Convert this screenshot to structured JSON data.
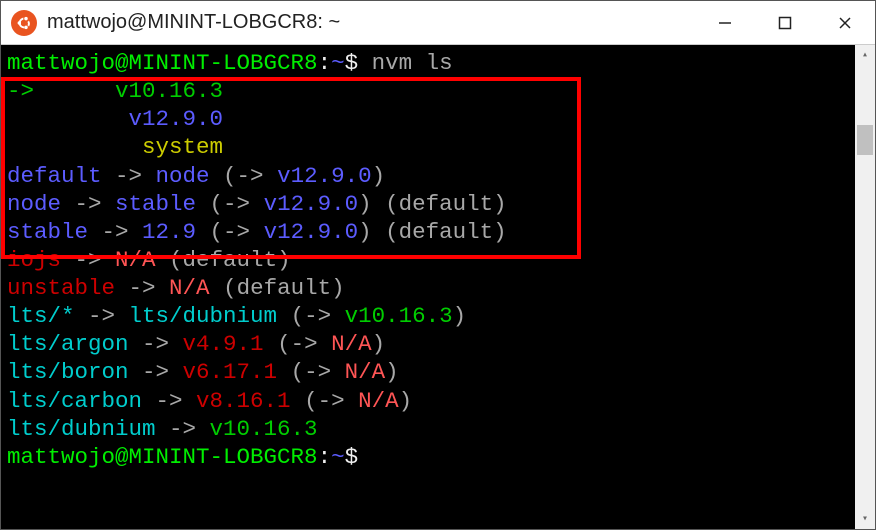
{
  "window": {
    "title": "mattwojo@MININT-LOBGCR8: ~"
  },
  "prompt": {
    "user_host": "mattwojo@MININT-LOBGCR8",
    "sep": ":",
    "path": "~",
    "dollar": "$"
  },
  "command": " nvm ls",
  "lines": {
    "arrow": "->",
    "v10": "v10.16.3",
    "v12": "v12.9.0",
    "system": "system",
    "default_k": "default",
    "to": " -> ",
    "node_w": "node",
    "pl": " (-> ",
    "pr": ")",
    "p_default": " (default)",
    "stable_w": "stable",
    "v129": "12.9",
    "iojs_k": "iojs",
    "na": "N/A",
    "unstable_k": "unstable",
    "lts_star": "lts/*",
    "lts_dubnium": "lts/dubnium",
    "lts_argon": "lts/argon",
    "lts_boron": "lts/boron",
    "lts_carbon": "lts/carbon",
    "v491": "v4.9.1",
    "v6171": "v6.17.1",
    "v8161": "v8.16.1",
    "v10163": "v10.16.3"
  }
}
